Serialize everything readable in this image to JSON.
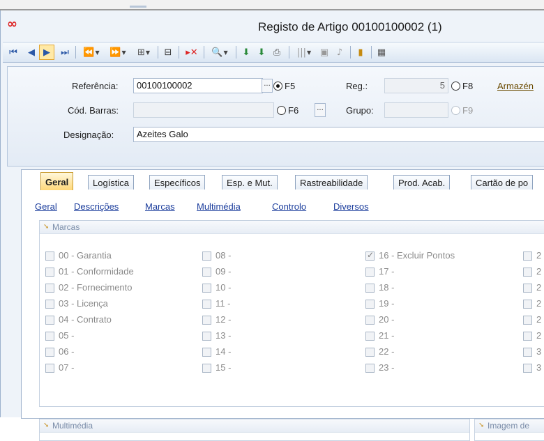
{
  "window": {
    "title": "Registo de Artigo 00100100002 (1)"
  },
  "header": {
    "referencia_label": "Referência:",
    "referencia_value": "00100100002",
    "f5_label": "F5",
    "reg_label": "Reg.:",
    "reg_value": "5",
    "f8_label": "F8",
    "armazem_link": "Armazén",
    "cod_barras_label": "Cód. Barras:",
    "f6_label": "F6",
    "grupo_label": "Grupo:",
    "f9_label": "F9",
    "designacao_label": "Designação:",
    "designacao_value": "Azeites Galo",
    "ellipsis": "..."
  },
  "tabs": [
    "Geral",
    "Logística",
    "Específicos",
    "Esp. e Mut.",
    "Rastreabilidade",
    "Prod. Acab.",
    "Cartão de po"
  ],
  "subnav": [
    "Geral",
    "Descrições",
    "Marcas",
    "Multimédia",
    "Controlo",
    "Diversos"
  ],
  "marcas": {
    "title": "Marcas",
    "col1": [
      "00 - Garantia",
      "01 - Conformidade",
      "02 - Fornecimento",
      "03 - Licença",
      "04 - Contrato",
      "05 -",
      "06 -",
      "07 -"
    ],
    "col2": [
      "08 -",
      "09 -",
      "10 -",
      "11 -",
      "12 -",
      "13 -",
      "14 -",
      "15 -"
    ],
    "col3": [
      "16 - Excluir Pontos",
      "17 -",
      "18 -",
      "19 -",
      "20 -",
      "21 -",
      "22 -",
      "23 -"
    ],
    "col4": [
      "2",
      "2",
      "2",
      "2",
      "2",
      "2",
      "3",
      "3"
    ],
    "checked": [
      "16 - Excluir Pontos"
    ]
  },
  "multimedia": {
    "title": "Multimédia"
  },
  "imagem": {
    "title": "Imagem de"
  },
  "colors": {
    "accent": "#ffd87a",
    "link": "#1a3c9c",
    "frame": "#eef3f9"
  }
}
